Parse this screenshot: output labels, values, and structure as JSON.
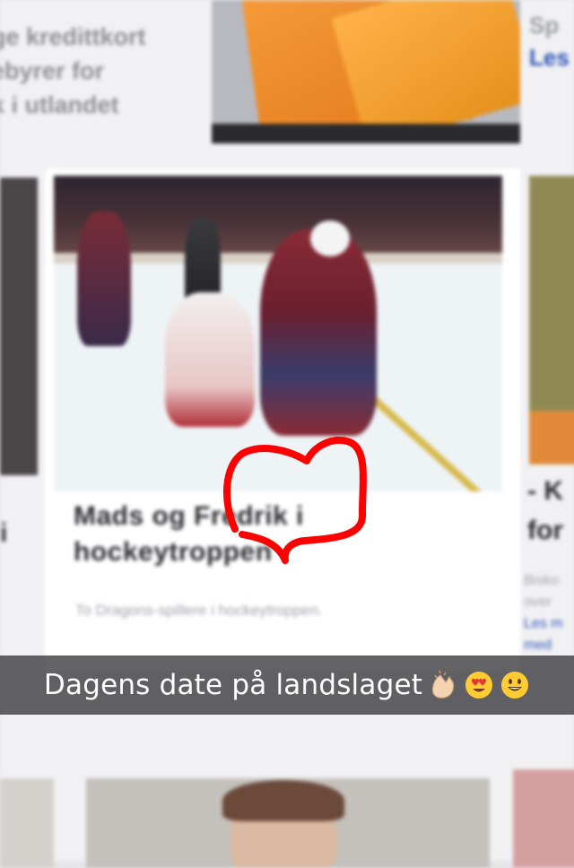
{
  "background_article": {
    "top_left_lines": [
      "ge kredittkort",
      "ebyrer for",
      "k i utlandet"
    ],
    "top_right_lines": [
      "Sp",
      "Les"
    ],
    "top_photo_caption": "",
    "main_headline": "Mads og Fredrik i hockeytroppen",
    "main_lede": "To Dragons-spillere i hockeytroppen.",
    "left_edge_letter": "i",
    "right_headline_lines": [
      "- K",
      "for"
    ],
    "right_small_lines": [
      "Bisko",
      "over",
      "Les m",
      "med"
    ]
  },
  "snap": {
    "caption": "Dagens date på landslaget",
    "emojis": [
      "clapping-hands",
      "heart-eyes-face",
      "grinning-face"
    ]
  },
  "colors": {
    "doodle_red": "#ff0000",
    "link_blue": "#2e55b8"
  }
}
